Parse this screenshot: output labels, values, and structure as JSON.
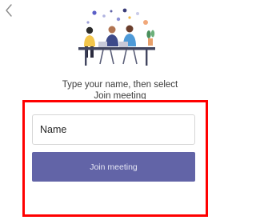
{
  "icons": {
    "back": "chevron-left-icon",
    "illustration": "people-meeting-illustration"
  },
  "instructions": {
    "line1": "Type your name, then select",
    "line2": "Join meeting"
  },
  "name_field": {
    "placeholder": "Name",
    "value": ""
  },
  "join_button": {
    "label": "Join meeting"
  },
  "colors": {
    "accent": "#6264a7",
    "highlight": "#ff0000"
  }
}
